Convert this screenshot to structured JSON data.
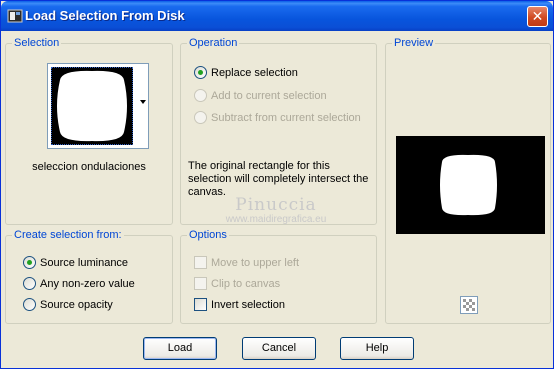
{
  "window": {
    "title": "Load Selection From Disk",
    "close_glyph": "✕"
  },
  "selection": {
    "group_title": "Selection",
    "file_name": "seleccion ondulaciones"
  },
  "operation": {
    "group_title": "Operation",
    "options": [
      {
        "label": "Replace selection",
        "checked": true,
        "enabled": true
      },
      {
        "label": "Add to current selection",
        "checked": false,
        "enabled": false
      },
      {
        "label": "Subtract from current selection",
        "checked": false,
        "enabled": false
      }
    ],
    "message": "The original rectangle for this selection will completely intersect the canvas."
  },
  "preview": {
    "group_title": "Preview"
  },
  "watermark": {
    "line1": "Pinuccia",
    "line2": "www.maidiregrafica.eu"
  },
  "create_from": {
    "group_title": "Create selection from:",
    "options": [
      {
        "label": "Source luminance",
        "checked": true
      },
      {
        "label": "Any non-zero value",
        "checked": false
      },
      {
        "label": "Source opacity",
        "checked": false
      }
    ]
  },
  "options": {
    "group_title": "Options",
    "items": [
      {
        "label": "Move to upper left",
        "checked": false,
        "enabled": false
      },
      {
        "label": "Clip to canvas",
        "checked": false,
        "enabled": false
      },
      {
        "label": "Invert selection",
        "checked": false,
        "enabled": true
      }
    ]
  },
  "buttons": {
    "load": "Load",
    "cancel": "Cancel",
    "help": "Help"
  },
  "colors": {
    "title_bar": "#0855dd",
    "group_title": "#0046d5",
    "dialog_bg": "#ece9d8",
    "radio_dot": "#21a121"
  }
}
